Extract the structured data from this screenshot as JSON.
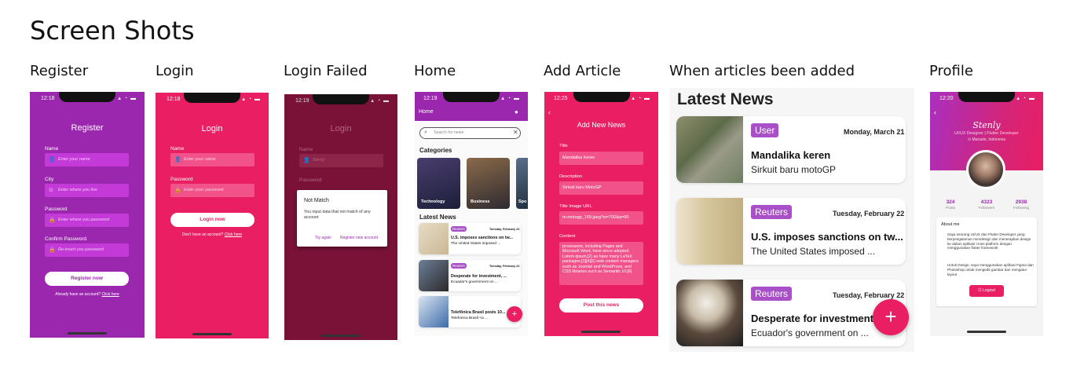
{
  "page": {
    "title": "Screen Shots",
    "labels": [
      "Register",
      "Login",
      "Login Failed",
      "Home",
      "Add Article",
      "When articles been added",
      "Profile"
    ]
  },
  "register": {
    "time": "12:18",
    "title": "Register",
    "fields": [
      {
        "label": "Name",
        "placeholder": "Enter your name",
        "icon": "person-icon"
      },
      {
        "label": "City",
        "placeholder": "Enter where you live",
        "icon": "location-icon"
      },
      {
        "label": "Password",
        "placeholder": "Enter where you password",
        "icon": "lock-icon"
      },
      {
        "label": "Confirm Password",
        "placeholder": "Re-insert you password",
        "icon": "lock-icon"
      }
    ],
    "button": "Register now",
    "footer_text": "Already have an account?",
    "footer_link": "Click here",
    "bg": "#9b27af"
  },
  "login": {
    "time": "12:18",
    "title": "Login",
    "fields": [
      {
        "label": "Name",
        "placeholder": "Enter your name",
        "icon": "person-icon"
      },
      {
        "label": "Password",
        "placeholder": "Enter your password",
        "icon": "lock-icon"
      }
    ],
    "button": "Login now",
    "footer_text": "Don't have an account?",
    "footer_link": "Click here",
    "bg": "#e91e63"
  },
  "login_failed": {
    "time": "12:19",
    "title": "Login",
    "name_label": "Name",
    "name_value": "Stenly",
    "password_label": "Password",
    "dialog_title": "Not Match",
    "dialog_body": "You input data that not match of any account",
    "try_again": "Try again",
    "register_new": "Register new account"
  },
  "home": {
    "time": "12:19",
    "appbar_title": "Home",
    "search_placeholder": "Search for news",
    "categories_title": "Categories",
    "categories": [
      "Technology",
      "Business",
      "Spo"
    ],
    "latest_title": "Latest News",
    "articles": [
      {
        "source": "Reuters",
        "date": "Tuesday, February 22",
        "title": "U.S. imposes sanctions on tw...",
        "desc": "The United States imposed ..."
      },
      {
        "source": "Reuters",
        "date": "Tuesday, February 22",
        "title": "Desperate for investment, ...",
        "desc": "Ecuador's government on ..."
      },
      {
        "source": "",
        "date": "",
        "title": "Telefônica Brasil posts 10...",
        "desc": "Telefonica Brasil <a ..."
      }
    ],
    "fab": "+"
  },
  "add_article": {
    "time": "12:25",
    "title": "Add New News",
    "fields": [
      {
        "label": "Title",
        "value": "Mandalika Keren"
      },
      {
        "label": "Description",
        "value": "Sirkuit baru MotoGP"
      },
      {
        "label": "Title Image URL",
        "value": "m-motogp_169.jpeg?w=700&q=90"
      }
    ],
    "content_label": "Content",
    "content_value": "processors, including Pages and Microsoft Word, have since adopted Lorem ipsum,[2] as have many LaTeX packages,[3][4][5] web content managers such as Joomla! and WordPress, and CSS libraries such as Semantic UI.[6]",
    "button": "Post this news"
  },
  "latest": {
    "title": "Latest News",
    "articles": [
      {
        "source": "User",
        "date": "Monday, March 21",
        "title": "Mandalika keren",
        "desc": "Sirkuit baru motoGP"
      },
      {
        "source": "Reuters",
        "date": "Tuesday, February 22",
        "title": "U.S. imposes sanctions on tw...",
        "desc": "The United States imposed ..."
      },
      {
        "source": "Reuters",
        "date": "Tuesday, February 22",
        "title": "Desperate for investment, ...",
        "desc": "Ecuador's government on ..."
      }
    ],
    "fab": "+"
  },
  "profile": {
    "time": "12:20",
    "name": "Stenly",
    "role": "UI/UX Designer | Flutter Developer",
    "location": "Manado, Indonesia",
    "stats": [
      {
        "value": "324",
        "label": "Posts"
      },
      {
        "value": "4323",
        "label": "Followers"
      },
      {
        "value": "2938",
        "label": "Following"
      }
    ],
    "about_title": "About me",
    "about_p1": "Saya seorang UI/UX dan Flutter Developer yang berpengalaman mendesign dan menerapkan design ke dalam aplikasi cross platform dengan menggunakan flutter framework",
    "about_p2": "Untuk Design, saya menggunakan aplikasi Figma dan Photoshop untuk mengedit gambar dan mengatur layout",
    "logout": "Logout"
  },
  "colors": {
    "purple": "#9b27af",
    "pink": "#e91e63",
    "dark_pink": "#7a1238",
    "badge_purple": "#a94fc8"
  }
}
